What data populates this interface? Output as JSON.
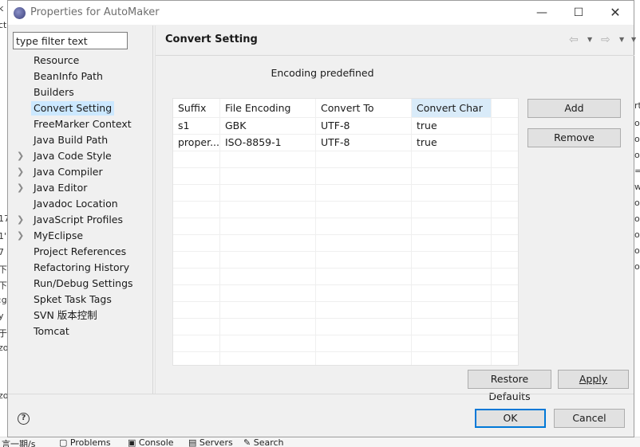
{
  "window": {
    "title": "Properties for AutoMaker"
  },
  "filter": {
    "placeholder": "type filter text"
  },
  "tree": [
    {
      "label": "Resource",
      "expandable": false,
      "selected": false
    },
    {
      "label": "BeanInfo Path",
      "expandable": false,
      "selected": false
    },
    {
      "label": "Builders",
      "expandable": false,
      "selected": false
    },
    {
      "label": "Convert Setting",
      "expandable": false,
      "selected": true
    },
    {
      "label": "FreeMarker Context",
      "expandable": false,
      "selected": false
    },
    {
      "label": "Java Build Path",
      "expandable": false,
      "selected": false
    },
    {
      "label": "Java Code Style",
      "expandable": true,
      "selected": false
    },
    {
      "label": "Java Compiler",
      "expandable": true,
      "selected": false
    },
    {
      "label": "Java Editor",
      "expandable": true,
      "selected": false
    },
    {
      "label": "Javadoc Location",
      "expandable": false,
      "selected": false
    },
    {
      "label": "JavaScript Profiles",
      "expandable": true,
      "selected": false
    },
    {
      "label": "MyEclipse",
      "expandable": true,
      "selected": false
    },
    {
      "label": "Project References",
      "expandable": false,
      "selected": false
    },
    {
      "label": "Refactoring History",
      "expandable": false,
      "selected": false
    },
    {
      "label": "Run/Debug Settings",
      "expandable": false,
      "selected": false
    },
    {
      "label": "Spket Task Tags",
      "expandable": false,
      "selected": false
    },
    {
      "label": "SVN 版本控制",
      "expandable": false,
      "selected": false
    },
    {
      "label": "Tomcat",
      "expandable": false,
      "selected": false
    }
  ],
  "page": {
    "title": "Convert Setting",
    "caption": "Encoding predefined",
    "table": {
      "columns": [
        "Suffix",
        "File Encoding",
        "Convert To",
        "Convert Char"
      ],
      "rows": [
        [
          "s1",
          "GBK",
          "UTF-8",
          "true"
        ],
        [
          "proper...",
          "ISO-8859-1",
          "UTF-8",
          "true"
        ]
      ]
    },
    "add_label": "Add",
    "remove_label": "Remove",
    "restore_label": "Restore Defaults",
    "apply_label": "Apply"
  },
  "footer": {
    "ok_label": "OK",
    "cancel_label": "Cancel"
  },
  "colors": {
    "selection": "#cce8ff",
    "default_button_border": "#0078d7",
    "active_column": "#d9ebf9"
  }
}
